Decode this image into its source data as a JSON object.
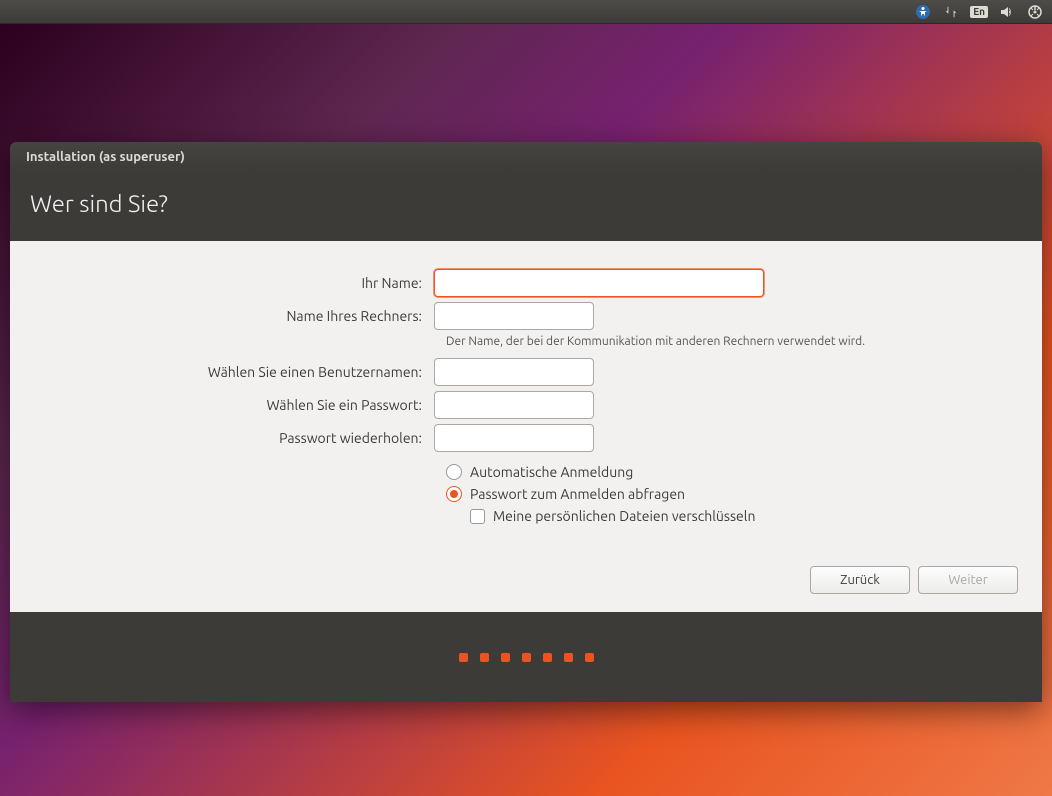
{
  "panel": {
    "lang": "En"
  },
  "window": {
    "title": "Installation (as superuser)",
    "heading": "Wer sind Sie?"
  },
  "form": {
    "name_label": "Ihr Name:",
    "hostname_label": "Name Ihres Rechners:",
    "hostname_hint": "Der Name, der bei der Kommunikation mit anderen Rechnern verwendet wird.",
    "username_label": "Wählen Sie einen Benutzernamen:",
    "password_label": "Wählen Sie ein Passwort:",
    "confirm_label": "Passwort wiederholen:",
    "auto_login_label": "Automatische Anmeldung",
    "require_password_label": "Passwort zum Anmelden abfragen",
    "encrypt_label": "Meine persönlichen Dateien verschlüsseln",
    "name_value": "",
    "hostname_value": "",
    "username_value": "",
    "password_value": "",
    "confirm_value": ""
  },
  "buttons": {
    "back": "Zurück",
    "forward": "Weiter"
  },
  "progress": {
    "dots": 7
  },
  "colors": {
    "accent": "#e95420",
    "panel_bg": "#3c3b37",
    "body_bg": "#f2f1f0"
  }
}
